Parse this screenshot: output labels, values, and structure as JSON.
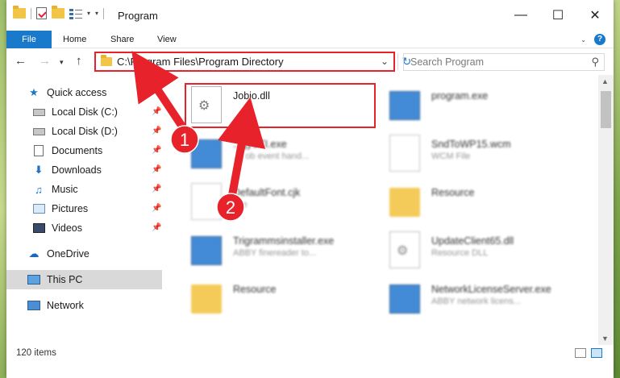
{
  "window": {
    "title": "Program"
  },
  "ribbon": {
    "tabs": [
      "File",
      "Home",
      "Share",
      "View"
    ]
  },
  "address": {
    "path": "C:\\Program Files\\Program Directory"
  },
  "search": {
    "placeholder": "Search Program"
  },
  "nav": {
    "items": [
      {
        "label": "Quick access",
        "icon": "star-icon"
      },
      {
        "label": "Local Disk (C:)",
        "icon": "drive-icon",
        "pinned": true
      },
      {
        "label": "Local Disk (D:)",
        "icon": "drive-icon",
        "pinned": true
      },
      {
        "label": "Documents",
        "icon": "documents-icon",
        "pinned": true
      },
      {
        "label": "Downloads",
        "icon": "downloads-icon",
        "pinned": true
      },
      {
        "label": "Music",
        "icon": "music-icon",
        "pinned": true
      },
      {
        "label": "Pictures",
        "icon": "pictures-icon",
        "pinned": true
      },
      {
        "label": "Videos",
        "icon": "videos-icon",
        "pinned": true
      },
      {
        "label": "OneDrive",
        "icon": "onedrive-icon"
      },
      {
        "label": "This PC",
        "icon": "this-pc-icon",
        "selected": true
      },
      {
        "label": "Network",
        "icon": "network-icon"
      }
    ]
  },
  "files": [
    {
      "name": "Jobio.dll",
      "sub": "",
      "icon": "dll-file-icon",
      "highlighted": true
    },
    {
      "name": "program.exe",
      "sub": "",
      "icon": "exe-file-icon"
    },
    {
      "name": "...gySTI.exe",
      "sub": "...t ob event hand...",
      "icon": "exe-file-icon"
    },
    {
      "name": "SndToWP15.wcm",
      "sub": "WCM File",
      "icon": "file-icon"
    },
    {
      "name": "DefaultFont.cjk",
      "sub": "...le",
      "icon": "file-icon"
    },
    {
      "name": "Resource",
      "sub": "",
      "icon": "folder-icon"
    },
    {
      "name": "Trigrammsinstaller.exe",
      "sub": "ABBY finereader to...",
      "icon": "exe-file-icon"
    },
    {
      "name": "UpdateClient65.dll",
      "sub": "Resource DLL",
      "icon": "dll-file-icon"
    },
    {
      "name": "Resource",
      "sub": "",
      "icon": "folder-icon"
    },
    {
      "name": "NetworkLicenseServer.exe",
      "sub": "ABBY network licens...",
      "icon": "exe-file-icon"
    }
  ],
  "status": {
    "count": "120 items"
  },
  "annotations": {
    "step1": "1",
    "step2": "2",
    "color": "#e8222a"
  }
}
